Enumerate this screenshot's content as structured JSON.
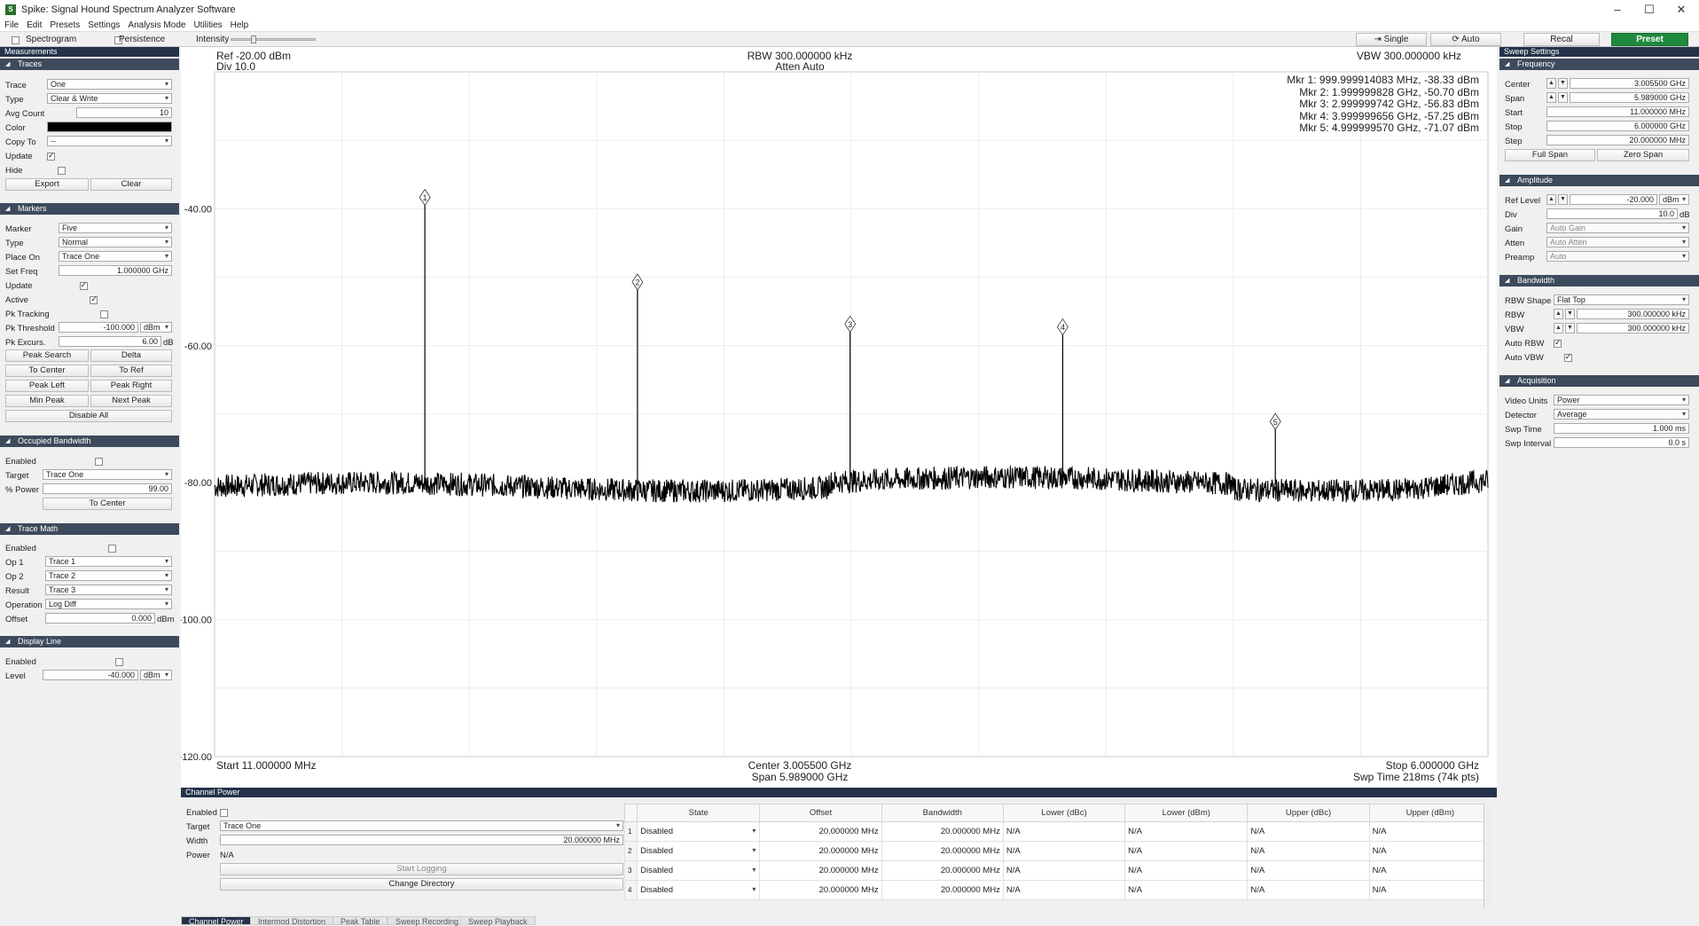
{
  "window": {
    "title": "Spike: Signal Hound Spectrum Analyzer Software"
  },
  "menu": [
    "File",
    "Edit",
    "Presets",
    "Settings",
    "Analysis Mode",
    "Utilities",
    "Help"
  ],
  "toolbar": {
    "spectrogram": "Spectrogram",
    "persistence": "Persistence",
    "intensity": "Intensity",
    "single": "Single",
    "auto": "Auto",
    "recal": "Recal",
    "preset": "Preset"
  },
  "left": {
    "title": "Measurements",
    "traces": {
      "header": "Traces",
      "labels": [
        "Trace",
        "Type",
        "Avg Count",
        "Color",
        "Copy To",
        "Update",
        "Hide"
      ],
      "trace": "One",
      "type": "Clear & Write",
      "avg_count": "10",
      "copy_to": "--",
      "export": "Export",
      "clear": "Clear"
    },
    "markers": {
      "header": "Markers",
      "labels": [
        "Marker",
        "Type",
        "Place On",
        "Set Freq",
        "Update",
        "Active",
        "Pk Tracking",
        "Pk Threshold",
        "Pk Excurs."
      ],
      "marker": "Five",
      "type": "Normal",
      "place_on": "Trace One",
      "set_freq": "1.000000 GHz",
      "pk_threshold": "-100.000",
      "pk_threshold_unit": "dBm",
      "pk_excurs": "6.00",
      "pk_excurs_unit": "dB",
      "buttons": [
        "Peak Search",
        "Delta",
        "To Center",
        "To Ref",
        "Peak Left",
        "Peak Right",
        "Min Peak",
        "Next Peak"
      ],
      "disable_all": "Disable All"
    },
    "occupied": {
      "header": "Occupied Bandwidth",
      "labels": [
        "Enabled",
        "Target",
        "% Power"
      ],
      "target": "Trace One",
      "power": "99.00",
      "to_center": "To Center"
    },
    "tracemath": {
      "header": "Trace Math",
      "labels": [
        "Enabled",
        "Op 1",
        "Op 2",
        "Result",
        "Operation",
        "Offset"
      ],
      "op1": "Trace 1",
      "op2": "Trace 2",
      "result": "Trace 3",
      "operation": "Log Diff",
      "offset": "0.000",
      "offset_unit": "dBm"
    },
    "displayline": {
      "header": "Display Line",
      "labels": [
        "Enabled",
        "Level"
      ],
      "level": "-40.000",
      "level_unit": "dBm"
    }
  },
  "plot": {
    "ref": "Ref -20.00 dBm",
    "div": "Div 10.0",
    "rbw": "RBW 300.000000 kHz",
    "atten": "Atten Auto",
    "vbw": "VBW 300.000000 kHz",
    "start": "Start 11.000000 MHz",
    "center": "Center 3.005500 GHz",
    "span": "Span 5.989000 GHz",
    "stop": "Stop 6.000000 GHz",
    "swp": "Swp Time 218ms (74k pts)",
    "marker_readouts": [
      "Mkr 1: 999.999914083 MHz, -38.33 dBm",
      "Mkr 2: 1.999999828 GHz, -50.70 dBm",
      "Mkr 3: 2.999999742 GHz, -56.83 dBm",
      "Mkr 4: 3.999999656 GHz, -57.25 dBm",
      "Mkr 5: 4.999999570 GHz, -71.07 dBm"
    ],
    "y_ticks": [
      "-40.00",
      "-60.00",
      "-80.00",
      "-100.00",
      "-120.00"
    ]
  },
  "chart_data": {
    "type": "line",
    "x_unit": "GHz",
    "y_unit": "dBm",
    "xlim": [
      0.011,
      6.0
    ],
    "ylim": [
      -120,
      -20
    ],
    "y_ticks": [
      -40,
      -60,
      -80,
      -100,
      -120
    ],
    "noise_floor_dbm": -80,
    "markers": [
      {
        "label": "1",
        "freq_ghz": 1.0,
        "level_dbm": -38.33
      },
      {
        "label": "2",
        "freq_ghz": 2.0,
        "level_dbm": -50.7
      },
      {
        "label": "3",
        "freq_ghz": 3.0,
        "level_dbm": -56.83
      },
      {
        "label": "4",
        "freq_ghz": 4.0,
        "level_dbm": -57.25
      },
      {
        "label": "5",
        "freq_ghz": 5.0,
        "level_dbm": -71.07
      }
    ],
    "grid": true
  },
  "right": {
    "title": "Sweep Settings",
    "frequency": {
      "header": "Frequency",
      "labels": [
        "Center",
        "Span",
        "Start",
        "Stop",
        "Step"
      ],
      "center": "3.005500 GHz",
      "span": "5.989000 GHz",
      "start": "11.000000 MHz",
      "stop": "6.000000 GHz",
      "step": "20.000000 MHz",
      "full_span": "Full Span",
      "zero_span": "Zero Span"
    },
    "amplitude": {
      "header": "Amplitude",
      "labels": [
        "Ref Level",
        "Div",
        "Gain",
        "Atten",
        "Preamp"
      ],
      "ref_level": "-20.000",
      "ref_unit": "dBm",
      "div": "10.0",
      "div_unit": "dB",
      "gain": "Auto Gain",
      "atten": "Auto Atten",
      "preamp": "Auto"
    },
    "bandwidth": {
      "header": "Bandwidth",
      "labels": [
        "RBW Shape",
        "RBW",
        "VBW",
        "Auto RBW",
        "Auto VBW"
      ],
      "shape": "Flat Top",
      "rbw": "300.000000 kHz",
      "vbw": "300.000000 kHz"
    },
    "acquisition": {
      "header": "Acquisition",
      "labels": [
        "Video Units",
        "Detector",
        "Swp Time",
        "Swp Interval"
      ],
      "video_units": "Power",
      "detector": "Average",
      "swp_time": "1.000 ms",
      "swp_interval": "0.0 s"
    }
  },
  "channel_power": {
    "title": "Channel Power",
    "labels": [
      "Enabled",
      "Target",
      "Width",
      "Power"
    ],
    "target": "Trace One",
    "width": "20.000000 MHz",
    "power": "N/A",
    "start_logging": "Start Logging",
    "change_directory": "Change Directory",
    "columns": [
      "State",
      "Offset",
      "Bandwidth",
      "Lower (dBc)",
      "Lower (dBm)",
      "Upper (dBc)",
      "Upper (dBm)"
    ],
    "rows": [
      {
        "n": "1",
        "state": "Disabled",
        "offset": "20.000000 MHz",
        "bw": "20.000000 MHz",
        "ldbc": "N/A",
        "ldbm": "N/A",
        "udbc": "N/A",
        "udbm": "N/A"
      },
      {
        "n": "2",
        "state": "Disabled",
        "offset": "20.000000 MHz",
        "bw": "20.000000 MHz",
        "ldbc": "N/A",
        "ldbm": "N/A",
        "udbc": "N/A",
        "udbm": "N/A"
      },
      {
        "n": "3",
        "state": "Disabled",
        "offset": "20.000000 MHz",
        "bw": "20.000000 MHz",
        "ldbc": "N/A",
        "ldbm": "N/A",
        "udbc": "N/A",
        "udbm": "N/A"
      },
      {
        "n": "4",
        "state": "Disabled",
        "offset": "20.000000 MHz",
        "bw": "20.000000 MHz",
        "ldbc": "N/A",
        "ldbm": "N/A",
        "udbc": "N/A",
        "udbm": "N/A"
      }
    ]
  },
  "bottom_tabs": [
    "Channel Power",
    "Intermod Distortion",
    "Peak Table",
    "Sweep Recording",
    "Sweep Playback"
  ]
}
